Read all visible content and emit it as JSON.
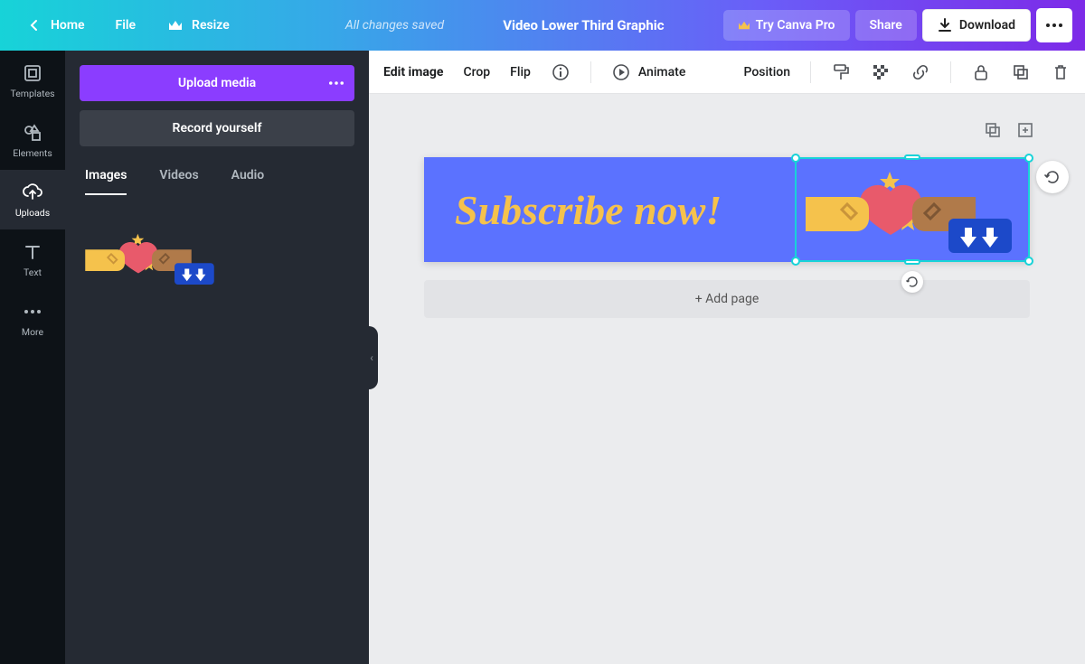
{
  "header": {
    "home": "Home",
    "file": "File",
    "resize": "Resize",
    "saved": "All changes saved",
    "doc_title": "Video Lower Third Graphic",
    "try_pro": "Try Canva Pro",
    "share": "Share",
    "download": "Download"
  },
  "rail": {
    "items": [
      {
        "label": "Templates"
      },
      {
        "label": "Elements"
      },
      {
        "label": "Uploads"
      },
      {
        "label": "Text"
      },
      {
        "label": "More"
      }
    ]
  },
  "panel": {
    "upload": "Upload media",
    "record": "Record yourself",
    "tabs": [
      "Images",
      "Videos",
      "Audio"
    ],
    "active_tab": "Images"
  },
  "toolbar": {
    "edit_image": "Edit image",
    "crop": "Crop",
    "flip": "Flip",
    "animate": "Animate",
    "position": "Position"
  },
  "canvas": {
    "text": "Subscribe now!",
    "add_page": "+ Add page"
  },
  "colors": {
    "accent_purple": "#8b3dff",
    "canvas_blue": "#5b72ff",
    "text_yellow": "#f5c24c",
    "select_cyan": "#17d3d8"
  }
}
